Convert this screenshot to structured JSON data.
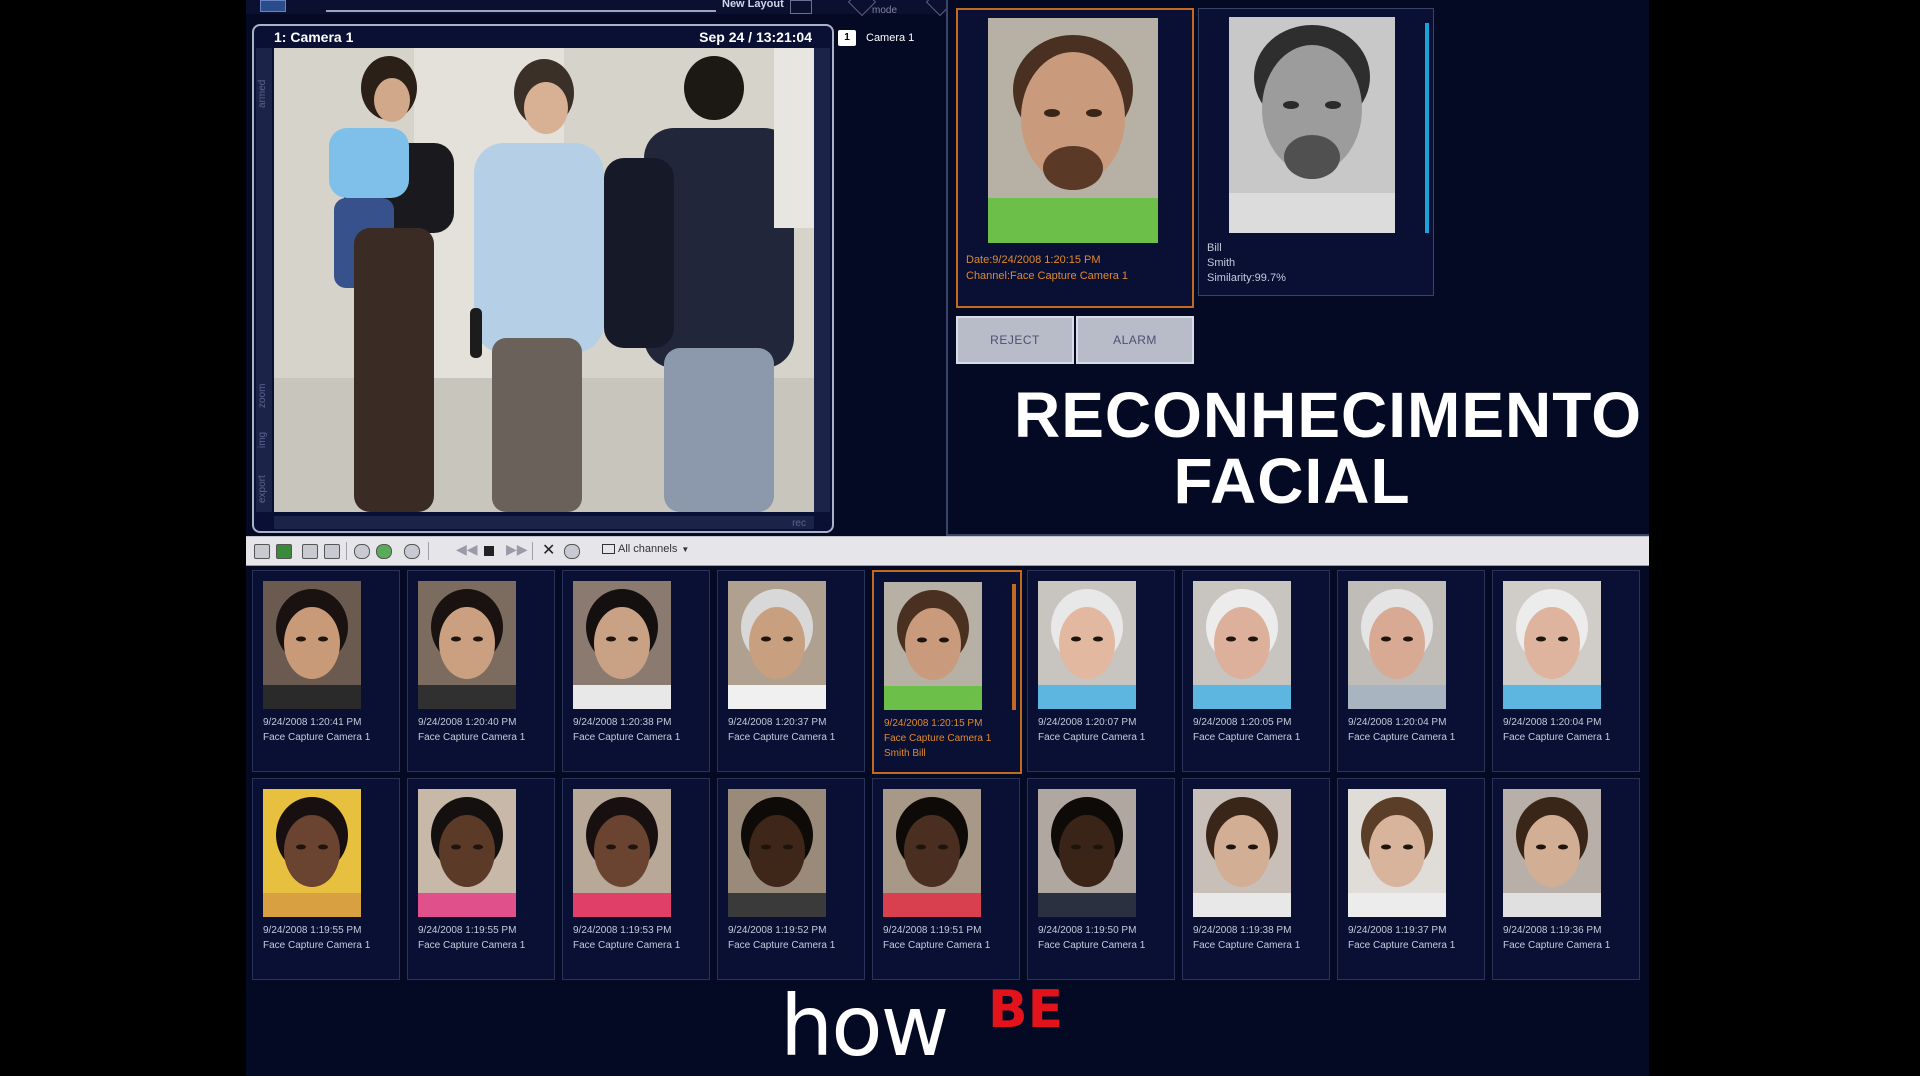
{
  "top": {
    "layout_label": "New Layout",
    "mode_label": "mode"
  },
  "camera": {
    "title": "1: Camera 1",
    "datetime": "Sep 24 / 13:21:04",
    "side_labels": [
      "armed",
      "zoom",
      "img",
      "export"
    ],
    "rec_label": "rec",
    "list_num": "1",
    "list_label": "Camera 1"
  },
  "match": {
    "capture_date": "Date:9/24/2008 1:20:15 PM",
    "capture_channel": "Channel:Face Capture Camera 1",
    "db_first": "Bill",
    "db_last": "Smith",
    "db_similarity": "Similarity:99.7%",
    "reject_label": "REJECT",
    "alarm_label": "ALARM"
  },
  "headline": {
    "line1": "RECONHECIMENTO",
    "line2": "FACIAL"
  },
  "toolbar": {
    "channels_label": "All channels"
  },
  "thumbnails": [
    {
      "time": "9/24/2008 1:20:41 PM",
      "channel": "Face Capture Camera 1",
      "match": "",
      "skin": "#c89a78",
      "hair": "#1a1210",
      "shirt": "#2a2a2a",
      "bg": "#6a5a50"
    },
    {
      "time": "9/24/2008 1:20:40 PM",
      "channel": "Face Capture Camera 1",
      "match": "",
      "skin": "#caa080",
      "hair": "#1a1210",
      "shirt": "#303030",
      "bg": "#7c6c60"
    },
    {
      "time": "9/24/2008 1:20:38 PM",
      "channel": "Face Capture Camera 1",
      "match": "",
      "skin": "#c9a286",
      "hair": "#141010",
      "shirt": "#e8e8e8",
      "bg": "#8a7a70"
    },
    {
      "time": "9/24/2008 1:20:37 PM",
      "channel": "Face Capture Camera 1",
      "match": "",
      "skin": "#c8a080",
      "hair": "#d8d8d8",
      "shirt": "#f0f0f0",
      "bg": "#b0a090"
    },
    {
      "time": "9/24/2008 1:20:15 PM",
      "channel": "Face Capture Camera 1",
      "match": "Smith Bill",
      "skin": "#c99a7c",
      "hair": "#4a3020",
      "shirt": "#6cc04a",
      "bg": "#b7b0a5"
    },
    {
      "time": "9/24/2008 1:20:07 PM",
      "channel": "Face Capture Camera 1",
      "match": "",
      "skin": "#e2b8a0",
      "hair": "#e8e8e8",
      "shirt": "#5cb6e0",
      "bg": "#c8c4c0"
    },
    {
      "time": "9/24/2008 1:20:05 PM",
      "channel": "Face Capture Camera 1",
      "match": "",
      "skin": "#dcb09a",
      "hair": "#ececec",
      "shirt": "#5cb6e0",
      "bg": "#c8c4c0"
    },
    {
      "time": "9/24/2008 1:20:04 PM",
      "channel": "Face Capture Camera 1",
      "match": "",
      "skin": "#d8aa94",
      "hair": "#e4e4e4",
      "shirt": "#a8b4c0",
      "bg": "#c0bcb8"
    },
    {
      "time": "9/24/2008 1:20:04 PM",
      "channel": "Face Capture Camera 1",
      "match": "",
      "skin": "#deb49e",
      "hair": "#ececec",
      "shirt": "#5cb6e0",
      "bg": "#d0ccc8"
    },
    {
      "time": "9/24/2008 1:19:55 PM",
      "channel": "Face Capture Camera 1",
      "match": "",
      "skin": "#6a4430",
      "hair": "#181010",
      "shirt": "#d8a040",
      "bg": "#e8c040"
    },
    {
      "time": "9/24/2008 1:19:55 PM",
      "channel": "Face Capture Camera 1",
      "match": "",
      "skin": "#5c3a28",
      "hair": "#141010",
      "shirt": "#e0508a",
      "bg": "#c8b8a8"
    },
    {
      "time": "9/24/2008 1:19:53 PM",
      "channel": "Face Capture Camera 1",
      "match": "",
      "skin": "#6a4430",
      "hair": "#181010",
      "shirt": "#e04068",
      "bg": "#b8a898"
    },
    {
      "time": "9/24/2008 1:19:52 PM",
      "channel": "Face Capture Camera 1",
      "match": "",
      "skin": "#3e2618",
      "hair": "#0e0a08",
      "shirt": "#3a3a3a",
      "bg": "#9a8a7a"
    },
    {
      "time": "9/24/2008 1:19:51 PM",
      "channel": "Face Capture Camera 1",
      "match": "",
      "skin": "#4a2e20",
      "hair": "#0e0a08",
      "shirt": "#d84050",
      "bg": "#a89888"
    },
    {
      "time": "9/24/2008 1:19:50 PM",
      "channel": "Face Capture Camera 1",
      "match": "",
      "skin": "#3a2418",
      "hair": "#0e0a08",
      "shirt": "#2a3040",
      "bg": "#b0a8a0"
    },
    {
      "time": "9/24/2008 1:19:38 PM",
      "channel": "Face Capture Camera 1",
      "match": "",
      "skin": "#d2ae94",
      "hair": "#3a2618",
      "shirt": "#e8e8e8",
      "bg": "#c8c0b8"
    },
    {
      "time": "9/24/2008 1:19:37 PM",
      "channel": "Face Capture Camera 1",
      "match": "",
      "skin": "#d8b49c",
      "hair": "#5a3e28",
      "shirt": "#ececec",
      "bg": "#e0dcd8"
    },
    {
      "time": "9/24/2008 1:19:36 PM",
      "channel": "Face Capture Camera 1",
      "match": "",
      "skin": "#d2ae94",
      "hair": "#3a2618",
      "shirt": "#e0e0e0",
      "bg": "#b8b0a8"
    }
  ],
  "logo": {
    "text_main": "how",
    "text_accent": "BE"
  },
  "colors": {
    "accent_orange": "#e08a2a",
    "accent_blue": "#1aa3d6",
    "logo_red": "#e3131b",
    "panel": "#050a24"
  }
}
